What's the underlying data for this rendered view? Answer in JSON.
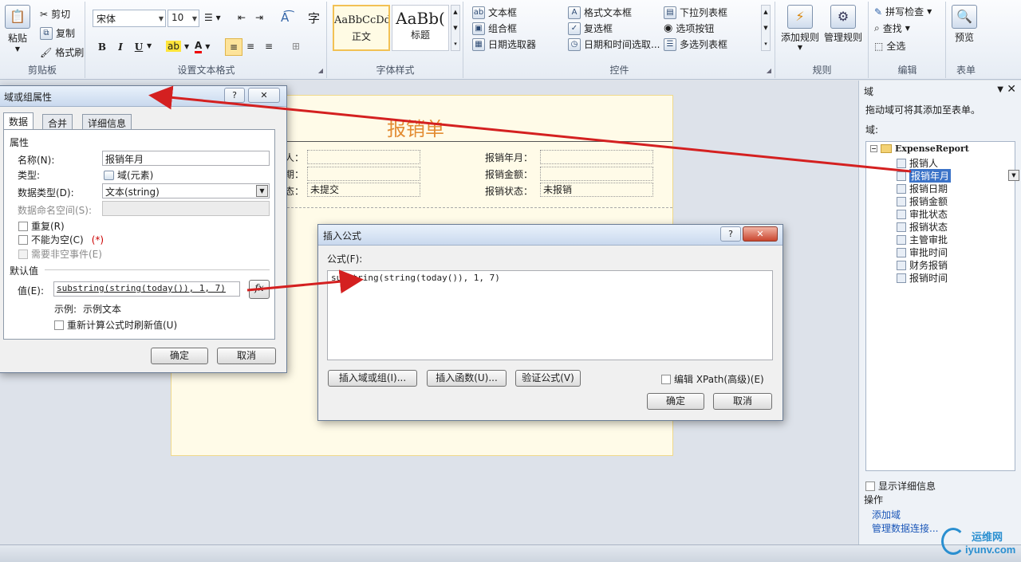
{
  "ribbon": {
    "clipboard": {
      "paste": "粘贴",
      "cut": "剪切",
      "copy": "复制",
      "format_painter": "格式刷",
      "group_label": "剪贴板"
    },
    "font": {
      "font_name": "宋体",
      "font_size": "10",
      "char_btn": "字",
      "group_label": "设置文本格式"
    },
    "styles": {
      "normal_sample": "AaBbCcDd",
      "normal_label": "正文",
      "heading_sample": "AaBb(",
      "heading_label": "标题",
      "group_label": "字体样式"
    },
    "controls": {
      "items": [
        "文本框",
        "格式文本框",
        "下拉列表框",
        "组合框",
        "复选框",
        "选项按钮",
        "日期选取器",
        "日期和时间选取...",
        "多选列表框"
      ],
      "group_label": "控件"
    },
    "rules": {
      "add_rule": "添加规则",
      "manage_rules": "管理规则",
      "group_label": "规则"
    },
    "editing": {
      "spell_check": "拼写检查",
      "find": "查找",
      "select_all": "全选",
      "group_label": "编辑"
    },
    "form": {
      "preview": "预览",
      "group_label": "表单"
    }
  },
  "form": {
    "title": "报销单",
    "labels": {
      "person_partial": "人：",
      "date_partial": "期：",
      "state_partial": "态：",
      "month": "报销年月：",
      "amount": "报销金额：",
      "status": "报销状态："
    },
    "values": {
      "submit_state": "未提交",
      "status_value": "未报销"
    }
  },
  "field_dialog": {
    "title": "域或组属性",
    "help": "?",
    "tabs": [
      "数据",
      "合并",
      "详细信息"
    ],
    "properties_heading": "属性",
    "name_label": "名称(N):",
    "name_value": "报销年月",
    "type_label": "类型:",
    "type_value": "域(元素)",
    "datatype_label": "数据类型(D):",
    "datatype_value": "文本(string)",
    "namespace_label": "数据命名空间(S):",
    "repeat_label": "重复(R)",
    "required_label": "不能为空(C)",
    "required_mark": "(*)",
    "nonempty_event_label": "需要非空事件(E)",
    "default_heading": "默认值",
    "value_label": "值(E):",
    "value_formula": "substring(string(today()), 1, 7)",
    "fx_button": "fx",
    "example_label": "示例:",
    "example_value": "示例文本",
    "recalc_label": "重新计算公式时刷新值(U)",
    "ok": "确定",
    "cancel": "取消"
  },
  "formula_dialog": {
    "title": "插入公式",
    "help": "?",
    "formula_label": "公式(F):",
    "formula_text": "substring(string(today()), 1, 7)",
    "insert_field": "插入域或组(I)...",
    "insert_function": "插入函数(U)...",
    "verify": "验证公式(V)",
    "edit_xpath": "编辑 XPath(高级)(E)",
    "ok": "确定",
    "cancel": "取消"
  },
  "pane": {
    "title": "域",
    "menu": "▼",
    "close": "✕",
    "description": "拖动域可将其添加至表单。",
    "domain_label": "域:",
    "root": "ExpenseReport",
    "fields": [
      "报销人",
      "报销年月",
      "报销日期",
      "报销金额",
      "审批状态",
      "报销状态",
      "主管审批",
      "审批时间",
      "财务报销",
      "报销时间"
    ],
    "show_details": "显示详细信息",
    "operations": "操作",
    "add_field": "添加域",
    "manage_connections": "管理数据连接..."
  },
  "watermark": {
    "top": "运维网",
    "bottom": "iyunv.com"
  },
  "colors": {
    "arrow": "#d42020",
    "form_title": "#e38c33",
    "selection": "#3b73c8",
    "link": "#1a56b8"
  }
}
